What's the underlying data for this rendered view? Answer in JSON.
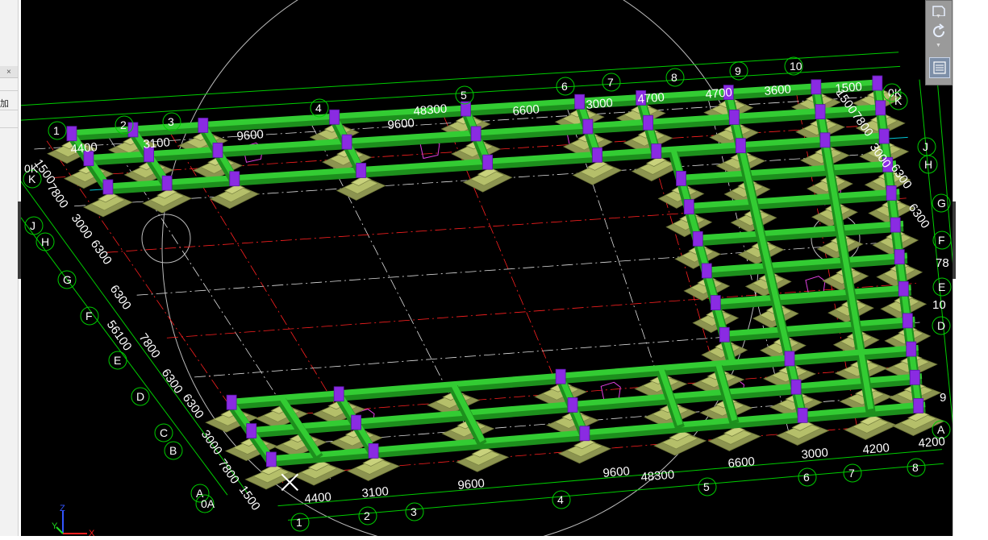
{
  "left_panel": {
    "close_label": "×",
    "clipped_label": "加"
  },
  "toolbar": {
    "cube_icon": "view-cube-icon",
    "orbit_icon": "orbit-icon",
    "properties_icon": "properties-icon"
  },
  "axes": {
    "z": "Z",
    "y": "Y",
    "x": "X"
  },
  "colors": {
    "background": "#000000",
    "beam": "#33cc33",
    "footing": "#b5bf6a",
    "column": "#8a2be2",
    "grid_line": "#00cc00",
    "axis_red": "#ff2020",
    "cyan": "#00c8d8",
    "magenta": "#e040e0"
  },
  "grid_labels": {
    "back_numbers": [
      "1",
      "2",
      "3",
      "4",
      "5",
      "6",
      "7",
      "8",
      "9",
      "10"
    ],
    "front_numbers": [
      "1",
      "2",
      "3",
      "4",
      "5",
      "6",
      "7",
      "8"
    ],
    "left_letters": [
      "K",
      "J",
      "H",
      "G",
      "F",
      "E",
      "D",
      "C",
      "B",
      "A",
      "0A"
    ],
    "right_letters": [
      "0K",
      "K",
      "J",
      "H",
      "G",
      "F",
      "E",
      "D",
      "A"
    ],
    "right_extra": [
      "78",
      "10",
      "9"
    ],
    "left_top_letters": [
      "0K"
    ]
  },
  "dimensions": {
    "back_top": [
      "48300",
      "4400",
      "3100",
      "9600",
      "9600",
      "6600",
      "3000",
      "4700",
      "4700",
      "3600",
      "1500"
    ],
    "left_side": [
      "1500",
      "7800",
      "3000",
      "6300",
      "6300",
      "56100",
      "7800",
      "6300",
      "6300",
      "3000",
      "7800",
      "1500"
    ],
    "right_side": [
      "1500",
      "7800",
      "3000",
      "6300",
      "6300"
    ],
    "front_bottom": [
      "4400",
      "3100",
      "9600",
      "9600",
      "48300",
      "6600",
      "3000",
      "4200",
      "4200"
    ]
  }
}
